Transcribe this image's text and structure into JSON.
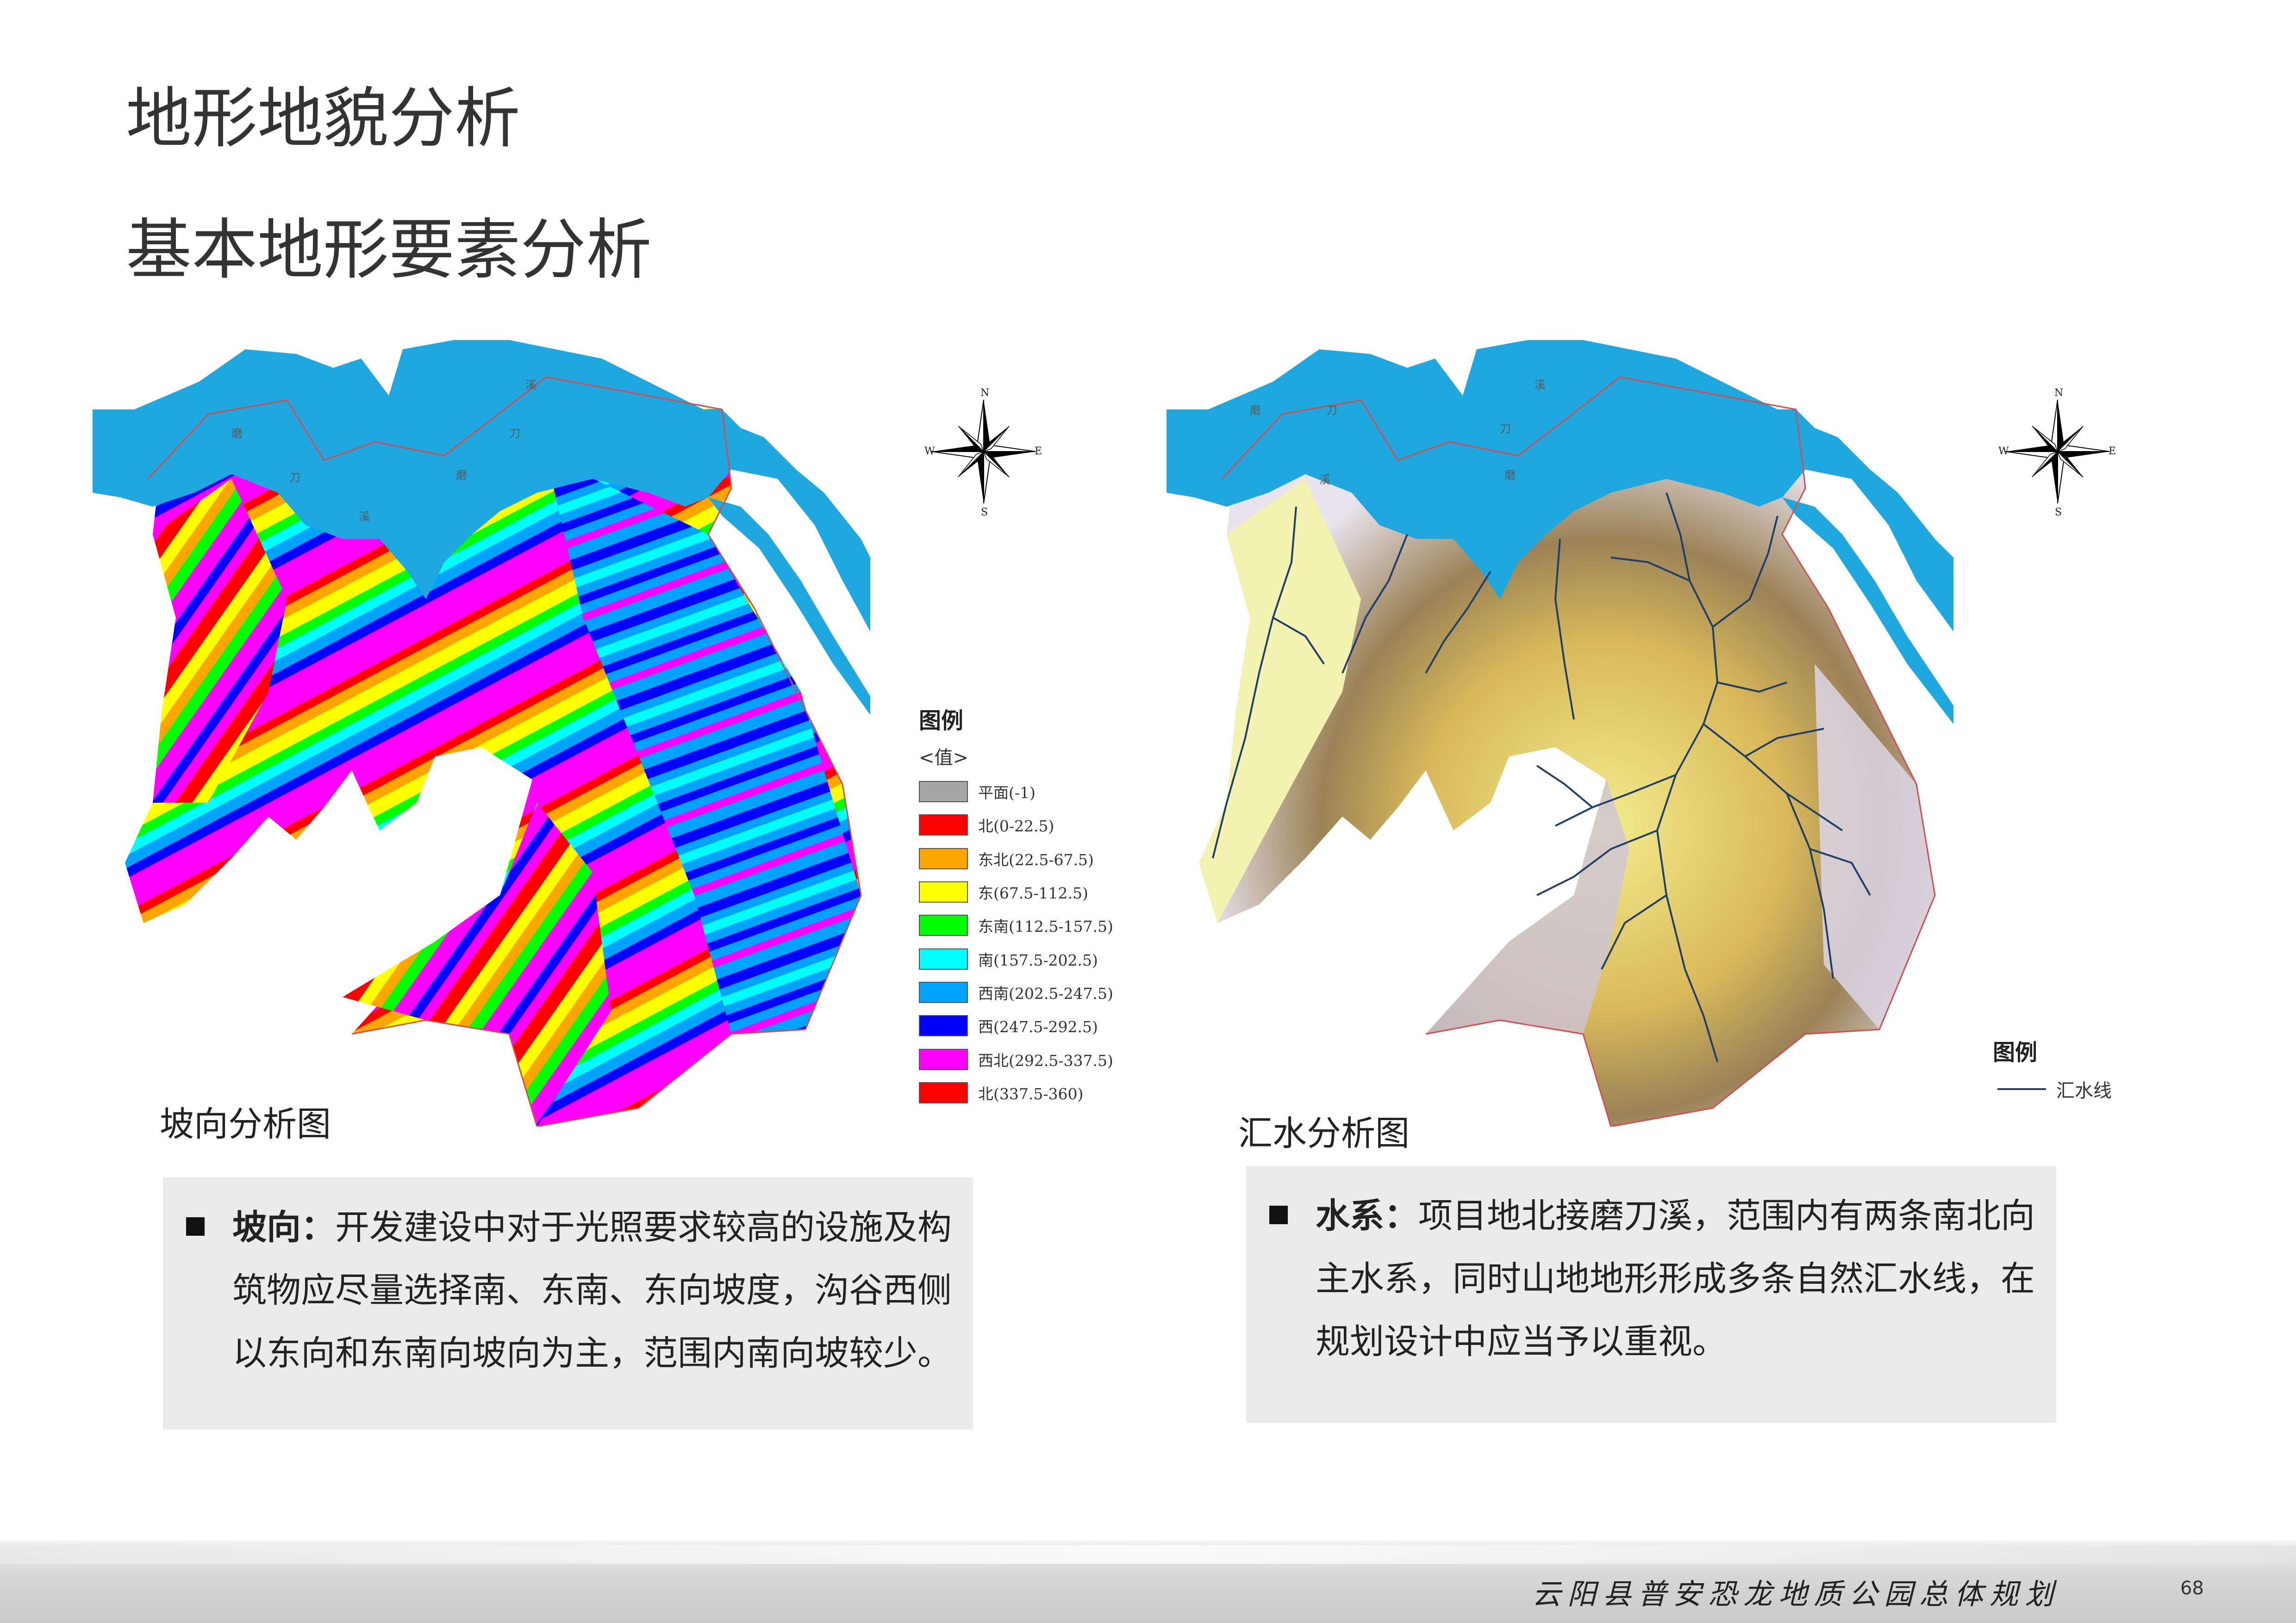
{
  "page": {
    "title": "地形地貌分析",
    "subtitle": "基本地形要素分析"
  },
  "map_left": {
    "caption": "坡向分析图",
    "map_labels": [
      "磨",
      "刀",
      "溪",
      "溪",
      "刀",
      "磨"
    ],
    "legend": {
      "title": "图例",
      "subtitle": "<值>",
      "items": [
        {
          "label": "平面(-1)",
          "color": "#a6a6a6"
        },
        {
          "label": "北(0-22.5)",
          "color": "#ff0000"
        },
        {
          "label": "东北(22.5-67.5)",
          "color": "#ffa500"
        },
        {
          "label": "东(67.5-112.5)",
          "color": "#ffff00"
        },
        {
          "label": "东南(112.5-157.5)",
          "color": "#00ff00"
        },
        {
          "label": "南(157.5-202.5)",
          "color": "#00ffff"
        },
        {
          "label": "西南(202.5-247.5)",
          "color": "#00a2ff"
        },
        {
          "label": "西(247.5-292.5)",
          "color": "#0000ff"
        },
        {
          "label": "西北(292.5-337.5)",
          "color": "#ff00ff"
        },
        {
          "label": "北(337.5-360)",
          "color": "#ff0000"
        }
      ]
    }
  },
  "map_right": {
    "caption": "汇水分析图",
    "map_labels": [
      "磨",
      "刀",
      "溪",
      "溪",
      "刀",
      "磨"
    ],
    "legend": {
      "title": "图例",
      "items": [
        {
          "label": "汇水线",
          "color": "#1f3f66"
        }
      ]
    }
  },
  "compass": {
    "n": "N",
    "s": "S",
    "e": "E",
    "w": "W"
  },
  "text_left": {
    "term": "坡向：",
    "body": "开发建设中对于光照要求较高的设施及构筑物应尽量选择南、东南、东向坡度，沟谷西侧以东向和东南向坡向为主，范围内南向坡较少。"
  },
  "text_right": {
    "term": "水系：",
    "body": "项目地北接磨刀溪，范围内有两条南北向主水系，同时山地地形形成多条自然汇水线，在规划设计中应当予以重视。"
  },
  "footer": {
    "project": "云阳县普安恐龙地质公园总体规划",
    "page_number": "68"
  },
  "colors": {
    "water": "#1fa7e0",
    "box_bg": "#ebebeb"
  }
}
